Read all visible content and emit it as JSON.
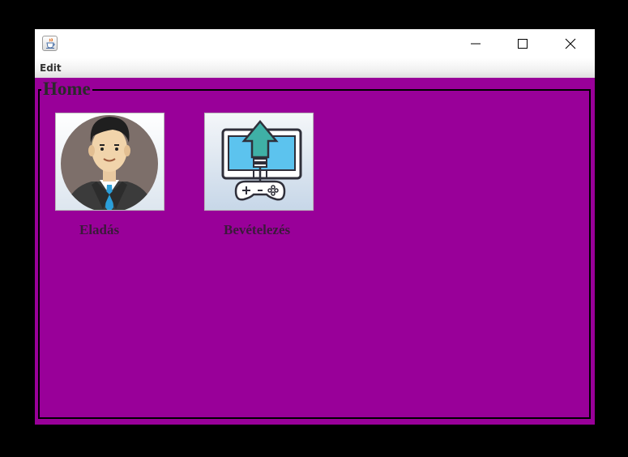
{
  "window": {
    "app_icon": "java-cup-icon",
    "controls": {
      "minimize": "minimize-icon",
      "maximize": "maximize-icon",
      "close": "close-icon"
    }
  },
  "menu": {
    "items": [
      "Edit"
    ]
  },
  "panel": {
    "title": "Home",
    "tiles": [
      {
        "label": "Eladás",
        "icon": "businessman-avatar-icon"
      },
      {
        "label": "Bevételezés",
        "icon": "upload-monitor-gamepad-icon"
      }
    ]
  },
  "colors": {
    "background": "#990099",
    "border": "#000000"
  }
}
